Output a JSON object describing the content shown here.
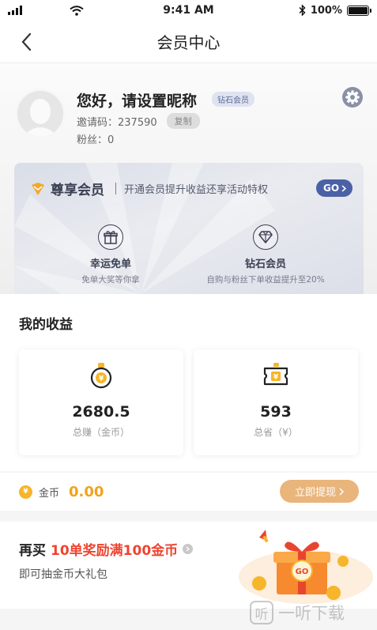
{
  "status_bar": {
    "time": "9:41 AM",
    "battery": "100%"
  },
  "nav": {
    "title": "会员中心",
    "back_icon": "chevron-left-icon"
  },
  "profile": {
    "greeting": "您好，请设置昵称",
    "level_tag": "钻石会员",
    "invite_label": "邀请码：",
    "invite_code": "237590",
    "copy_label": "复制",
    "fans_label": "粉丝：",
    "fans_count": "0",
    "settings_icon": "gear-icon"
  },
  "vip_card": {
    "title": "尊享会员",
    "description": "开通会员提升收益还享活动特权",
    "go_label": "GO",
    "benefits": [
      {
        "icon": "gift-icon",
        "title": "幸运免单",
        "subtitle": "免单大奖等你拿"
      },
      {
        "icon": "diamond-icon",
        "title": "钻石会员",
        "subtitle": "自购与粉丝下单收益提升至20%"
      }
    ]
  },
  "earnings": {
    "title": "我的收益",
    "cards": [
      {
        "icon": "coin-bag-icon",
        "value": "2680.5",
        "label": "总赚（金币）"
      },
      {
        "icon": "ticket-icon",
        "value": "593",
        "label": "总省（¥）"
      }
    ]
  },
  "coins": {
    "label": "金币",
    "value": "0.00",
    "withdraw_label": "立即提现"
  },
  "promo": {
    "prefix": "再买",
    "highlight": "10单奖励满100金币",
    "subtitle": "即可抽金币大礼包",
    "box_label": "GO"
  },
  "watermark": {
    "text": "一听下载",
    "logo": "听"
  },
  "colors": {
    "accent_gold": "#f0a31c",
    "promo_red": "#f0432f",
    "go_blue": "#4b61a6",
    "withdraw_bg": "#e9b57b"
  }
}
